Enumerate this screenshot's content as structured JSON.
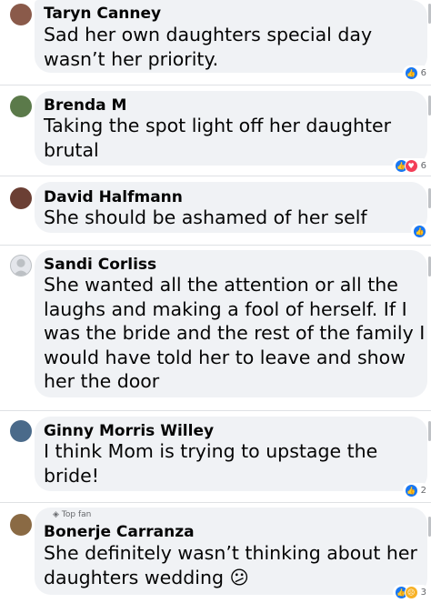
{
  "comments": [
    {
      "name": "Taryn Canney",
      "text": "Sad her own daughters special day\nwasn’t her priority.",
      "reaction_count": "6",
      "reactions": [
        "like-icon"
      ],
      "avatar_color": "#8a5a4a"
    },
    {
      "name": "Brenda M",
      "text": "Taking the spot light off her daughter\nbrutal",
      "reaction_count": "6",
      "reactions": [
        "like-icon",
        "love-icon"
      ],
      "avatar_color": "#5b7a4a"
    },
    {
      "name": "David Halfmann",
      "text": "She should be ashamed of her self",
      "reaction_count": "",
      "reactions": [
        "like-icon"
      ],
      "avatar_color": "#6b3f34"
    },
    {
      "name": "Sandi Corliss",
      "text": "She wanted all the attention or all the\nlaughs and making a fool of herself. If I\nwas the bride and the rest of the family I\nwould have told her to leave and show\nher the door",
      "reaction_count": "",
      "reactions": [],
      "avatar_color": "#bcc0c4"
    },
    {
      "name": "Ginny Morris Willey",
      "text": "I think Mom is trying to upstage the\nbride!",
      "reaction_count": "2",
      "reactions": [
        "like-icon"
      ],
      "avatar_color": "#4a6a8a"
    },
    {
      "name": "Bonerje Carranza",
      "badge": "Top fan",
      "text": "She definitely wasn’t thinking about her\ndaughters wedding 😕",
      "reaction_count": "3",
      "reactions": [
        "like-icon",
        "sad-icon"
      ],
      "avatar_color": "#8a6a44"
    }
  ],
  "colors": {
    "like": "#1877f2",
    "love": "#f33e58",
    "sad": "#f7b125",
    "bubble": "#f0f2f5"
  }
}
